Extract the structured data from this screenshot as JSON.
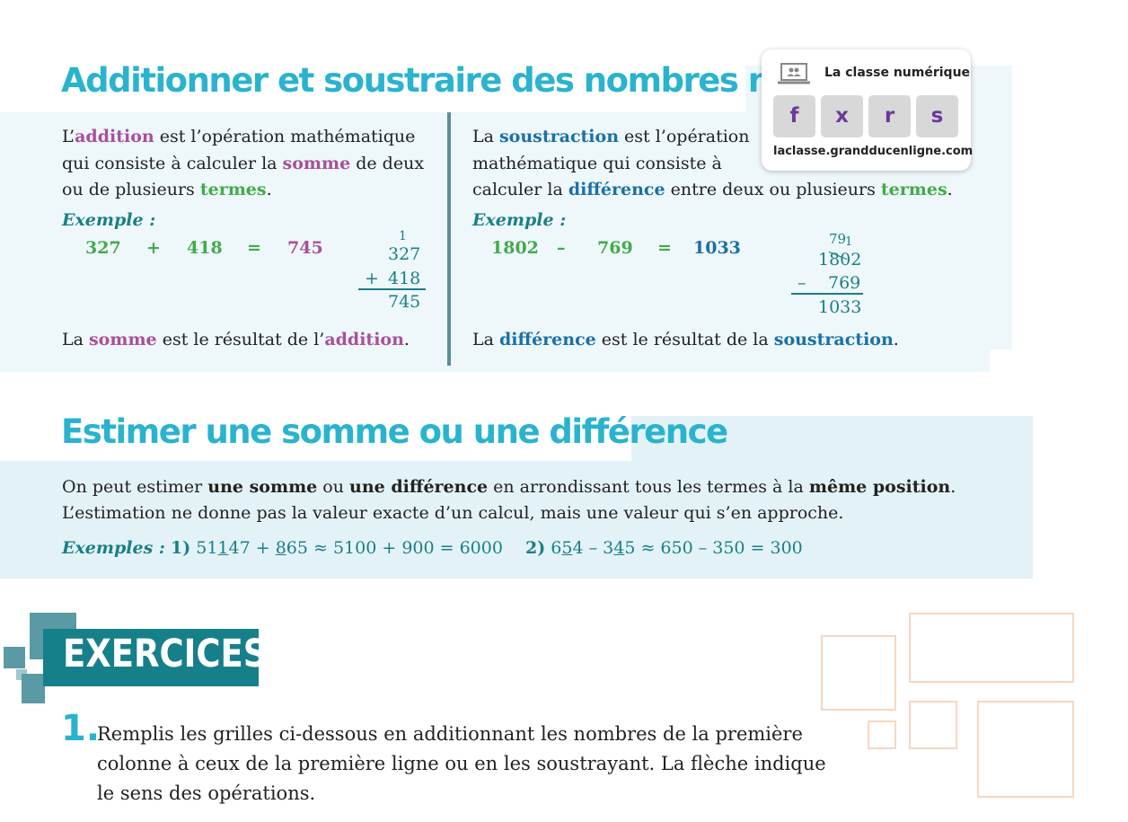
{
  "section1": {
    "title": "Additionner et soustraire des nombres naturels",
    "addition": {
      "p1": "L’",
      "w_addition": "addition",
      "p2": " est l’opération mathématique qui consiste à calculer la ",
      "w_somme": "somme",
      "p3": " de deux ou de plusieurs ",
      "w_termes": "termes",
      "p4": ".",
      "example_label": "Exemple :",
      "ex_a": "327",
      "ex_op": "+",
      "ex_b": "418",
      "ex_eq": "=",
      "ex_r": "745",
      "col_carry": "1",
      "col_a": "327",
      "col_op": "+",
      "col_b": "418",
      "col_r": "745",
      "c1": "La ",
      "c_somme": "somme",
      "c2": " est le résultat de l’",
      "c_addition": "addition",
      "c3": "."
    },
    "subtraction": {
      "p1": "La ",
      "w_soustraction": "soustraction",
      "p2a": " est l’opération",
      "p2b": "mathématique qui consiste à",
      "p2c": "calculer la ",
      "w_difference": "différence",
      "p3": " entre deux ou plusieurs ",
      "w_termes": "termes",
      "p4": ".",
      "example_label": "Exemple :",
      "ex_a": "1802",
      "ex_op": "–",
      "ex_b": "769",
      "ex_eq": "=",
      "ex_r": "1033",
      "col_borrow": "79",
      "col_borrow_small": "1",
      "col_a": "1802",
      "col_op": "–",
      "col_b": "769",
      "col_r": "1033",
      "c1": "La ",
      "c_difference": "différence",
      "c2": " est le résultat de la ",
      "c_soustraction": "soustraction",
      "c3": "."
    }
  },
  "share": {
    "label": "La classe numérique",
    "buttons": [
      "f",
      "x",
      "r",
      "s"
    ],
    "url": "laclasse.grandducenligne.com"
  },
  "section2": {
    "title": "Estimer une somme ou une différence",
    "l1a": "On peut estimer ",
    "l1b": "une somme",
    "l1c": " ou ",
    "l1d": "une différence",
    "l1e": " en arrondissant tous les termes à la ",
    "l1f": "même position",
    "l1g": ".",
    "l2": "L’estimation ne donne pas la valeur exacte d’un calcul, mais une valeur qui s’en approche.",
    "examples_label": "Exemples :",
    "ex1_num": "1)",
    "ex1_a1": "51",
    "ex1_a2": "1",
    "ex1_a3": "47 + ",
    "ex1_b1": "8",
    "ex1_b2": "65 ≈ 5100 + 900 = 6000",
    "ex2_num": "2)",
    "ex2_a1": "6",
    "ex2_a2": "5",
    "ex2_a3": "4 – 3",
    "ex2_b1": "4",
    "ex2_b2": "5 ≈ 650 – 350 = 300"
  },
  "exercices": {
    "banner": "EXERCICES",
    "q1_number": "1.",
    "q1_text_1": "Remplis les grilles ci-dessous en additionnant les nombres de la première",
    "q1_text_2": "colonne à ceux de la première ligne ou en les soustrayant. La flèche indique",
    "q1_text_3": "le sens des opérations."
  },
  "colors": {
    "title": "#2ab3cf",
    "addition_purple": "#a8509a",
    "terms_green": "#44aa4c",
    "subtraction_blue": "#1a70a8",
    "example_teal": "#1a7f86",
    "banner_teal": "#16808a"
  }
}
